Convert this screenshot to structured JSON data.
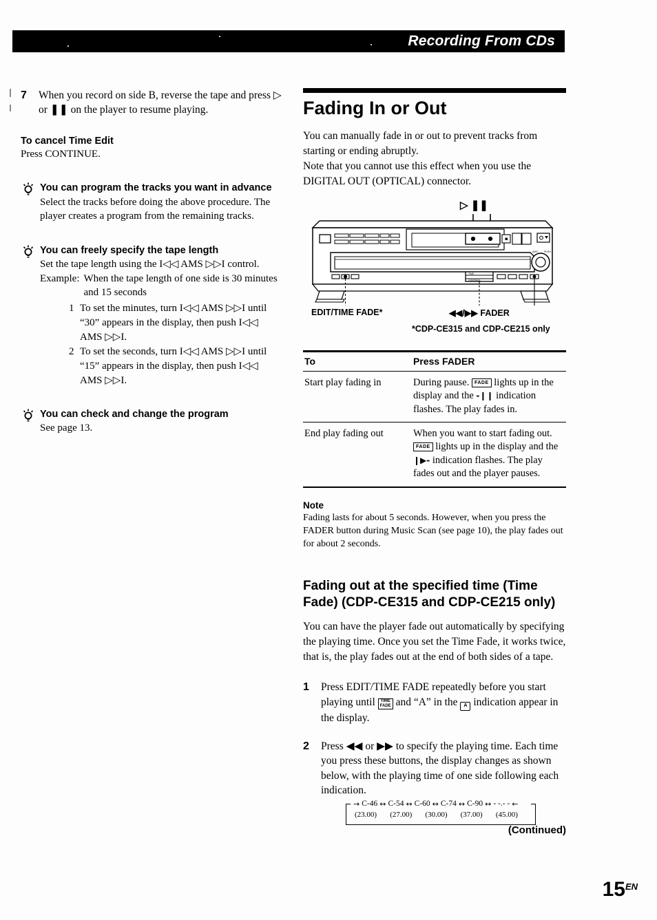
{
  "header": {
    "title": "Recording From CDs"
  },
  "left_column": {
    "step7": {
      "number": "7",
      "text_parts": {
        "before": "When you record on side B, reverse the tape and press ",
        "play_symbol": "▷",
        "middle": " or ",
        "pause_symbol": "❚❚",
        "after": " on the player to resume playing."
      },
      "full_text": "When you record on side B, reverse the tape and press ▷ or ❚❚ on the player to resume playing."
    },
    "cancel_section": {
      "heading": "To cancel Time Edit",
      "text": "Press CONTINUE."
    },
    "tips": [
      {
        "title": "You can program the tracks you want in advance",
        "text": "Select the tracks before doing the above procedure. The player creates a program from the remaining tracks."
      },
      {
        "title": "You can freely specify the tape length",
        "text": "Set the tape length using the I◁◁ AMS ▷▷I control.",
        "example_label": "Example:",
        "example_text": "When the tape length of one side is 30 minutes and 15 seconds",
        "steps": [
          {
            "number": "1",
            "text": "To set the minutes, turn I◁◁ AMS ▷▷I until “30” appears in the display, then push I◁◁ AMS ▷▷I."
          },
          {
            "number": "2",
            "text": "To set the seconds, turn I◁◁ AMS ▷▷I until “15” appears in the display, then push I◁◁ AMS ▷▷I."
          }
        ]
      },
      {
        "title": "You can check and change the program",
        "text": "See page 13."
      }
    ]
  },
  "right_column": {
    "section_title": "Fading In or Out",
    "intro": "You can manually fade in or out to prevent tracks from starting or ending abruptly.\nNote that you cannot use this effect when you use the DIGITAL OUT (OPTICAL) connector.",
    "figure": {
      "top_callout": "▷ ❚❚",
      "label_edit": "EDIT/TIME FADE*",
      "label_fader": "◀◀/▶▶  FADER",
      "footnote": "*CDP-CE315 and CDP-CE215 only"
    },
    "table": {
      "headers": [
        "To",
        "Press FADER"
      ],
      "rows": [
        {
          "to": "Start play fading in",
          "press_parts": {
            "p1": "During pause. ",
            "icon1": "FADE",
            "p2": " lights up in the display and the ",
            "icon2": "-❙❙",
            "p3": " indication flashes. The play fades in."
          },
          "press_full": "During pause. [FADE] lights up in the display and the -❙❙ indication flashes. The play fades in."
        },
        {
          "to": "End play fading out",
          "press_parts": {
            "p1": "When you want to start fading out. ",
            "icon1": "FADE",
            "p2": " lights up in the display and the ",
            "icon2": "❙▶-",
            "p3": " indication flashes. The play fades out and the player pauses."
          },
          "press_full": "When you want to start fading out. [FADE] lights up in the display and the ❙▶- indication flashes. The play fades out and the player pauses."
        }
      ]
    },
    "note": {
      "heading": "Note",
      "text": "Fading lasts for about 5 seconds. However, when you press the FADER button during Music Scan (see page 10), the play fades out for about 2 seconds."
    },
    "time_fade": {
      "title": "Fading out at the specified time (Time Fade) (CDP-CE315 and CDP-CE215 only)",
      "intro": "You can have the player fade out automatically by specifying the playing time. Once you set the Time Fade, it works twice, that is, the play fades out at the end of both sides of a tape.",
      "steps": [
        {
          "number": "1",
          "parts": {
            "p1": "Press EDIT/TIME FADE repeatedly before you start playing until ",
            "icon_time": "TIME",
            "icon_fade": "FADE",
            "p2": " and “A” in the ",
            "icon_cassette": "A",
            "p3": " indication appear in the display."
          },
          "full_text": "Press EDIT/TIME FADE repeatedly before you start playing until [TIME FADE] and “A” in the [A] indication appear in the display."
        },
        {
          "number": "2",
          "parts": {
            "p1": "Press ",
            "rew": "◀◀",
            "p2": " or ",
            "ffw": "▶▶",
            "p3": " to specify the playing time. Each time you press these buttons, the display changes as shown below, with the playing time of one side following each indication."
          },
          "full_text": "Press ◀◀ or ▶▶ to specify the playing time. Each time you press these buttons, the display changes as shown below, with the playing time of one side following each indication."
        }
      ],
      "sequence": {
        "tape_labels": [
          "C-46",
          "C-54",
          "C-60",
          "C-74",
          "C-90",
          "- -.- -"
        ],
        "times": [
          "(23.00)",
          "(27.00)",
          "(30.00)",
          "(37.00)",
          "(45.00)"
        ],
        "arrow": "↔",
        "lead_arrow": "→",
        "tail_arrow": "←"
      }
    }
  },
  "footer": {
    "continued": "(Continued)",
    "page_number": "15",
    "page_suffix": "EN"
  }
}
